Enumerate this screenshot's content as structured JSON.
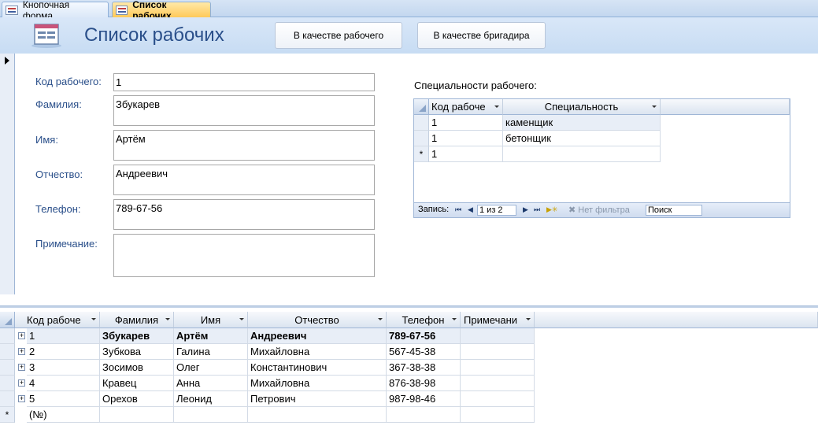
{
  "tabs": [
    {
      "label": "Кнопочная форма",
      "active": false
    },
    {
      "label": "Список рабочих",
      "active": true
    }
  ],
  "header": {
    "title": "Список рабочих",
    "button_worker": "В качестве рабочего",
    "button_foreman": "В качестве бригадира"
  },
  "form": {
    "code_label": "Код рабочего:",
    "code_value": "1",
    "lastname_label": "Фамилия:",
    "lastname_value": "Збукарев",
    "firstname_label": "Имя:",
    "firstname_value": "Артём",
    "patronymic_label": "Отчество:",
    "patronymic_value": "Андреевич",
    "phone_label": "Телефон:",
    "phone_value": "789-67-56",
    "note_label": "Примечание:",
    "note_value": ""
  },
  "subform": {
    "label": "Специальности рабочего:",
    "columns": [
      "Код рабоче",
      "Специальность"
    ],
    "rows": [
      {
        "code": "1",
        "specialty": "каменщик"
      },
      {
        "code": "1",
        "specialty": "бетонщик"
      }
    ],
    "new_row_code": "1",
    "new_row_marker": "*",
    "nav": {
      "record_label": "Запись:",
      "position": "1 из 2",
      "filter": "Нет фильтра",
      "search": "Поиск"
    }
  },
  "datasheet": {
    "columns": [
      "Код рабоче",
      "Фамилия",
      "Имя",
      "Отчество",
      "Телефон",
      "Примечани"
    ],
    "rows": [
      {
        "code": "1",
        "lastname": "Збукарев",
        "firstname": "Артём",
        "patronymic": "Андреевич",
        "phone": "789-67-56"
      },
      {
        "code": "2",
        "lastname": "Зубкова",
        "firstname": "Галина",
        "patronymic": "Михайловна",
        "phone": "567-45-38"
      },
      {
        "code": "3",
        "lastname": "Зосимов",
        "firstname": "Олег",
        "patronymic": "Константинович",
        "phone": "367-38-38"
      },
      {
        "code": "4",
        "lastname": "Кравец",
        "firstname": "Анна",
        "patronymic": "Михайловна",
        "phone": "876-38-98"
      },
      {
        "code": "5",
        "lastname": "Орехов",
        "firstname": "Леонид",
        "patronymic": "Петрович",
        "phone": "987-98-46"
      }
    ],
    "new_row_code": "(№)",
    "new_row_marker": "*"
  }
}
